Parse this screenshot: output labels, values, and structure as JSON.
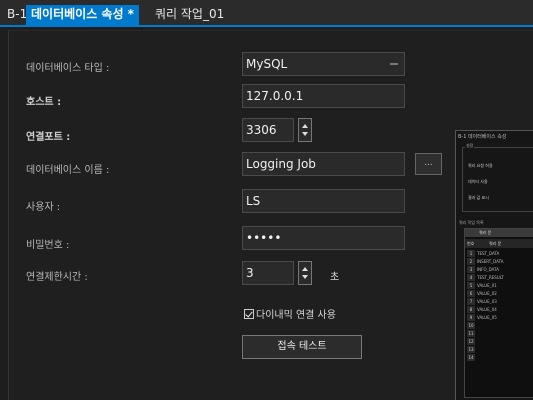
{
  "tabs": [
    {
      "label": "B-1"
    },
    {
      "label": "데이터베이스 속성 *"
    },
    {
      "label": "쿼리 작업_01"
    }
  ],
  "form": {
    "db_type": {
      "label": "데이터베이스 타입 :",
      "value": "MySQL"
    },
    "host": {
      "label": "호스트 :",
      "value": "127.0.0.1"
    },
    "port": {
      "label": "연결포트 :",
      "value": "3306"
    },
    "db_name": {
      "label": "데이터베이스 이름 :",
      "value": "Logging Job",
      "browse_label": "..."
    },
    "user": {
      "label": "사용자 :",
      "value": "LS"
    },
    "password": {
      "label": "비밀번호 :",
      "value": "•••••"
    },
    "timeout": {
      "label": "연결제한시간 :",
      "value": "3",
      "unit": "초"
    },
    "dynamic_connect": {
      "label": "다이내믹 연결 사용",
      "checked": true
    },
    "test_button": {
      "label": "접속 테스트"
    }
  },
  "thumbnail": {
    "title": "B-1 데이터베이스 속성",
    "group_label": "설정",
    "options": [
      "쿼리 요청 허용",
      "데이터 사용",
      "결과 값 표시"
    ],
    "table_label": "쿼리 작업 목록",
    "header": [
      "번호",
      "쿼리 문"
    ],
    "rows": [
      {
        "n": "1",
        "v": "TEST_DATA"
      },
      {
        "n": "2",
        "v": "INSERT_DATA"
      },
      {
        "n": "3",
        "v": "INFO_DATA"
      },
      {
        "n": "4",
        "v": "TEST_RESULT"
      },
      {
        "n": "5",
        "v": "VALUE_01"
      },
      {
        "n": "6",
        "v": "VALUE_02"
      },
      {
        "n": "7",
        "v": "VALUE_03"
      },
      {
        "n": "8",
        "v": "VALUE_04"
      },
      {
        "n": "9",
        "v": "VALUE_05"
      },
      {
        "n": "10",
        "v": ""
      },
      {
        "n": "11",
        "v": ""
      },
      {
        "n": "12",
        "v": ""
      },
      {
        "n": "13",
        "v": ""
      },
      {
        "n": "14",
        "v": ""
      }
    ]
  }
}
